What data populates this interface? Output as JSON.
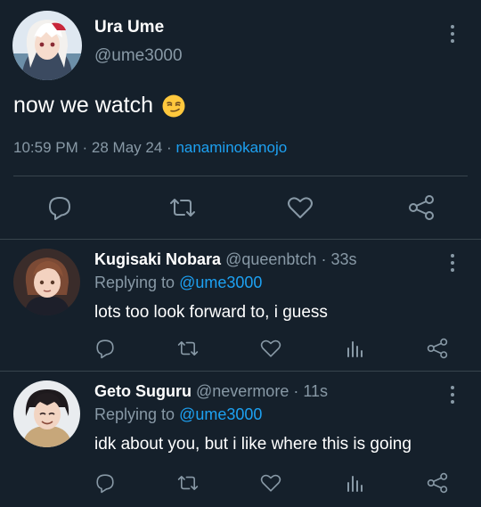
{
  "colors": {
    "background": "#15202b",
    "text": "#ffffff",
    "secondary": "#8899a6",
    "link": "#1da1f2",
    "divider": "#38444d"
  },
  "main_tweet": {
    "author_name": "Ura Ume",
    "author_handle": "@ume3000",
    "text": "now we watch",
    "emoji": "smirking-face-emoji",
    "time": "10:59 PM",
    "date": "28 May 24",
    "source": "nanaminokanojo",
    "separator": "·",
    "actions": [
      "reply-icon",
      "retweet-icon",
      "like-icon",
      "share-icon"
    ]
  },
  "replies": [
    {
      "author_name": "Kugisaki Nobara",
      "author_handle": "@queenbtch",
      "age": "33s",
      "replying_prefix": "Replying to",
      "replying_to": "@ume3000",
      "text": "lots too look forward to, i guess",
      "actions": [
        "reply-icon",
        "retweet-icon",
        "like-icon",
        "analytics-icon",
        "share-icon"
      ]
    },
    {
      "author_name": "Geto Suguru",
      "author_handle": "@nevermore",
      "age": "11s",
      "replying_prefix": "Replying to",
      "replying_to": "@ume3000",
      "text": "idk about you, but i like where this is going",
      "actions": [
        "reply-icon",
        "retweet-icon",
        "like-icon",
        "analytics-icon",
        "share-icon"
      ]
    }
  ]
}
